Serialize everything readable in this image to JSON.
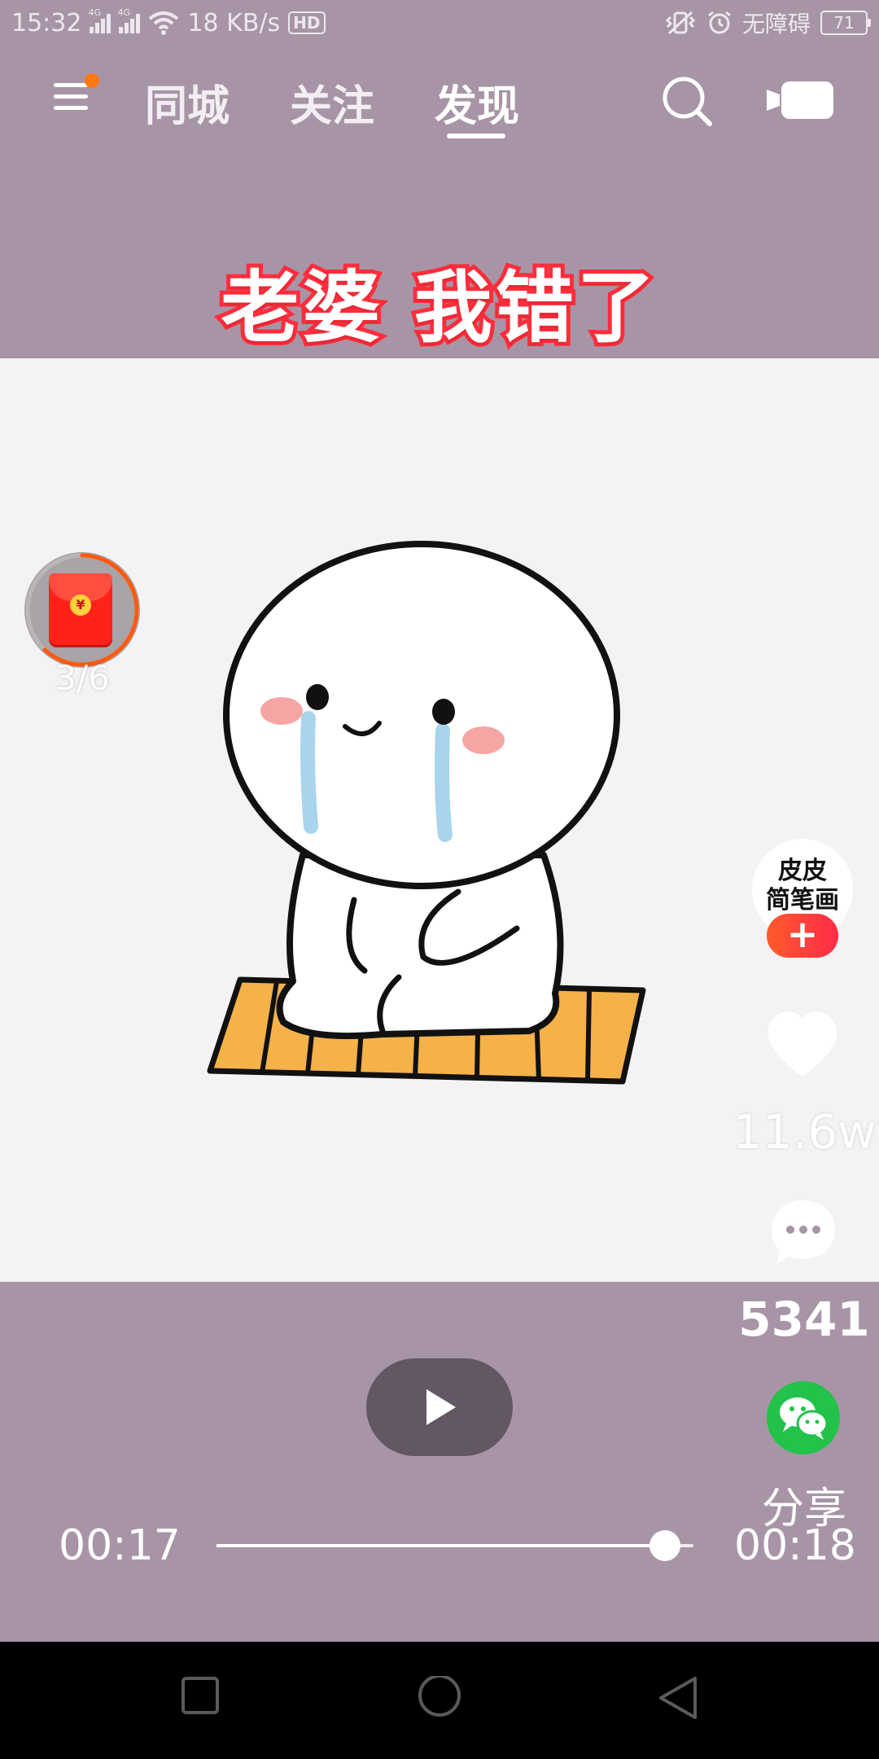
{
  "status_bar": {
    "time": "15:32",
    "net_1": "4G",
    "net_2": "4G",
    "speed": "18 KB/s",
    "hd": "HD",
    "accessibility": "无障碍",
    "battery": "71"
  },
  "top_nav": {
    "tabs": [
      {
        "label": "同城"
      },
      {
        "label": "关注"
      },
      {
        "label": "发现",
        "active": true
      }
    ]
  },
  "video": {
    "title": "老婆 我错了"
  },
  "red_packet": {
    "coin": "¥",
    "count": "3/6",
    "ring_progress": 0.62
  },
  "actions": {
    "author_line1": "皮皮",
    "author_line2": "简笔画",
    "follow": "+",
    "likes": "11.6w",
    "comments": "5341",
    "share": "分享"
  },
  "player": {
    "current_time": "00:17",
    "total_time": "00:18",
    "progress": 0.94
  },
  "colors": {
    "background": "#a795a7",
    "title_stroke": "#ff2d3b",
    "follow": "#ff3a3a",
    "share": "#22c24b",
    "packet": "#ff2219"
  },
  "icons": [
    "menu-icon",
    "search-icon",
    "camera-icon",
    "red-packet-icon",
    "heart-icon",
    "comment-icon",
    "wechat-icon",
    "play-icon",
    "nav-square-icon",
    "nav-circle-icon",
    "nav-triangle-icon"
  ]
}
